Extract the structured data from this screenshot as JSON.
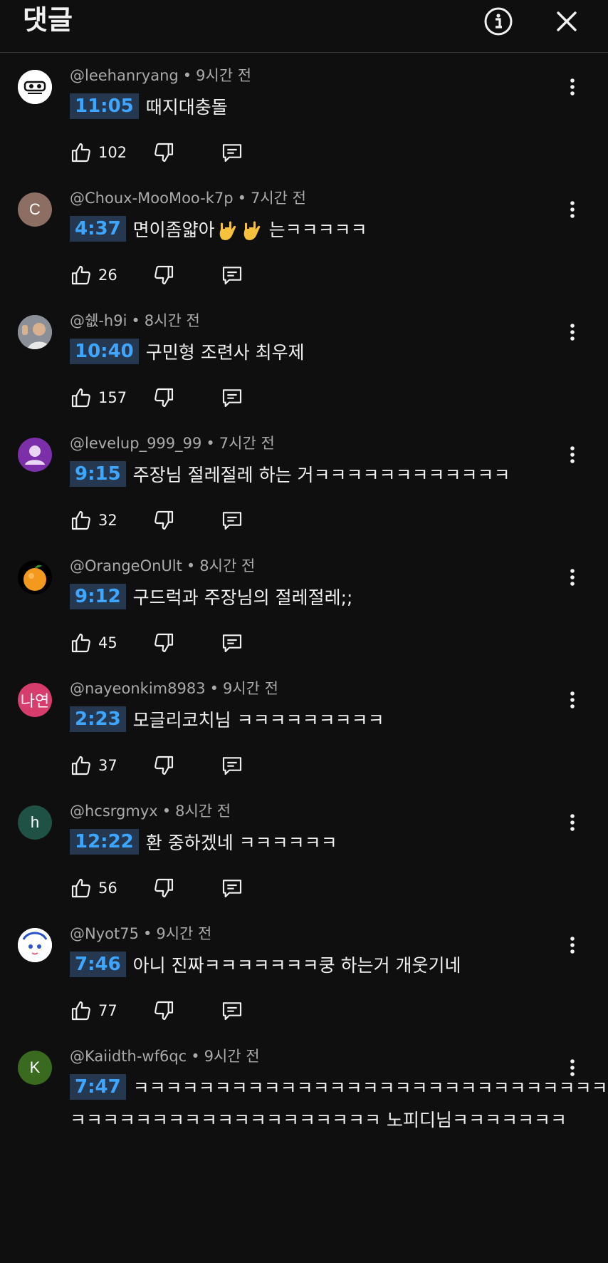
{
  "header": {
    "title": "댓글"
  },
  "comments": [
    {
      "author": "@leehanryang",
      "age": "9시간 전",
      "timestamp": "11:05",
      "text": "때지대충돌",
      "text2": "",
      "likes": "102",
      "avatar": {
        "kind": "image",
        "letter": "",
        "color": "#ffffff"
      }
    },
    {
      "author": "@Choux-MooMoo-k7p",
      "age": "7시간 전",
      "timestamp": "4:37",
      "text": "면이좀얇아",
      "text_after_emoji": "는ㅋㅋㅋㅋㅋ",
      "text2": "",
      "likes": "26",
      "avatar": {
        "kind": "letter",
        "letter": "C",
        "color": "#8d6e63"
      }
    },
    {
      "author": "@쉢-h9i",
      "age": "8시간 전",
      "timestamp": "10:40",
      "text": "구민형 조련사 최우제",
      "text2": "",
      "likes": "157",
      "avatar": {
        "kind": "image",
        "letter": "",
        "color": "#c9b79c"
      }
    },
    {
      "author": "@levelup_999_99",
      "age": "7시간 전",
      "timestamp": "9:15",
      "text": "주장님 절레절레 하는 거ㅋㅋㅋㅋㅋㅋㅋㅋㅋㅋㅋㅋ",
      "text2": "",
      "likes": "32",
      "avatar": {
        "kind": "person",
        "letter": "",
        "color": "#7b2fa8"
      }
    },
    {
      "author": "@OrangeOnUlt",
      "age": "8시간 전",
      "timestamp": "9:12",
      "text": "구드럭과 주장님의 절레절레;;",
      "text2": "",
      "likes": "45",
      "avatar": {
        "kind": "orange",
        "letter": "",
        "color": "#000000"
      }
    },
    {
      "author": "@nayeonkim8983",
      "age": "9시간 전",
      "timestamp": "2:23",
      "text": "모글리코치님 ㅋㅋㅋㅋㅋㅋㅋㅋㅋ",
      "text2": "",
      "likes": "37",
      "avatar": {
        "kind": "letter",
        "letter": "나연",
        "color": "#d63c6c"
      }
    },
    {
      "author": "@hcsrgmyx",
      "age": "8시간 전",
      "timestamp": "12:22",
      "text": "환 중하겠네 ㅋㅋㅋㅋㅋㅋ",
      "text2": "",
      "likes": "56",
      "avatar": {
        "kind": "letter",
        "letter": "h",
        "color": "#1f5144"
      }
    },
    {
      "author": "@Nyot75",
      "age": "9시간 전",
      "timestamp": "7:46",
      "text": "아니 진짜ㅋㅋㅋㅋㅋㅋㅋ쿵 하는거 개웃기네",
      "text2": "",
      "likes": "77",
      "avatar": {
        "kind": "image",
        "letter": "",
        "color": "#ffffff"
      }
    },
    {
      "author": "@Kaiidth-wf6qc",
      "age": "9시간 전",
      "timestamp": "7:47",
      "text": "ㅋㅋㅋㅋㅋㅋㅋㅋㅋㅋㅋㅋㅋㅋㅋㅋㅋㅋㅋㅋㅋㅋㅋㅋㅋㅋㅋㅋㅋㅋ",
      "text2": "ㅋㅋㅋㅋㅋㅋㅋㅋㅋㅋㅋㅋㅋㅋㅋㅋㅋㅋㅋ 노피디님ㅋㅋㅋㅋㅋㅋㅋ",
      "likes": "",
      "avatar": {
        "kind": "letter",
        "letter": "K",
        "color": "#3a6a1f"
      }
    }
  ]
}
